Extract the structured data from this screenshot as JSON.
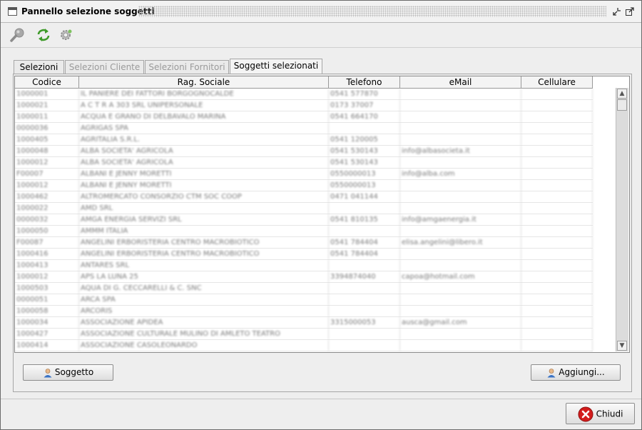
{
  "window": {
    "title": "Pannello selezione soggetti"
  },
  "toolbar": {
    "icons": [
      "search-icon",
      "refresh-icon",
      "settings-icon"
    ]
  },
  "tabs": [
    {
      "label": "Selezioni",
      "state": "enabled"
    },
    {
      "label": "Selezioni Cliente",
      "state": "disabled"
    },
    {
      "label": "Selezioni Fornitori",
      "state": "disabled"
    },
    {
      "label": "Soggetti selezionati",
      "state": "active"
    }
  ],
  "table": {
    "columns": [
      "Codice",
      "Rag. Sociale",
      "Telefono",
      "eMail",
      "Cellulare"
    ],
    "rows": [
      [
        "1000001",
        "IL PANIERE DEI FATTORI BORGOGNOCALDE",
        "0541 577870",
        "",
        ""
      ],
      [
        "1000021",
        "A C T R A 303 SRL UNIPERSONALE",
        "0173 37007",
        "",
        ""
      ],
      [
        "1000011",
        "ACQUA E GRANO DI DELBAVALO MARINA",
        "0541 664170",
        "",
        ""
      ],
      [
        "0000036",
        "AGRIGAS SPA",
        "",
        "",
        ""
      ],
      [
        "1000405",
        "AGRITALIA S.R.L.",
        "0541 120005",
        "",
        ""
      ],
      [
        "1000048",
        "ALBA SOCIETA' AGRICOLA",
        "0541 530143",
        "info@albasocieta.it",
        ""
      ],
      [
        "1000012",
        "ALBA SOCIETA' AGRICOLA",
        "0541 530143",
        "",
        ""
      ],
      [
        "F00007",
        "ALBANI E JENNY MORETTI",
        "0550000013",
        "info@alba.com",
        ""
      ],
      [
        "1000012",
        "ALBANI E JENNY MORETTI",
        "0550000013",
        "",
        ""
      ],
      [
        "1000462",
        "ALTROMERCATO CONSORZIO CTM SOC COOP",
        "0471 041144",
        "",
        ""
      ],
      [
        "1000022",
        "AMD SRL",
        "",
        "",
        ""
      ],
      [
        "0000032",
        "AMGA ENERGIA SERVIZI SRL",
        "0541 810135",
        "info@amgaenergia.it",
        ""
      ],
      [
        "1000050",
        "AMMM ITALIA",
        "",
        "",
        ""
      ],
      [
        "F00087",
        "ANGELINI ERBORISTERIA CENTRO MACROBIOTICO",
        "0541 784404",
        "elisa.angelini@libero.it",
        ""
      ],
      [
        "1000416",
        "ANGELINI ERBORISTERIA CENTRO MACROBIOTICO",
        "0541 784404",
        "",
        ""
      ],
      [
        "1000413",
        "ANTARES SRL",
        "",
        "",
        ""
      ],
      [
        "1000012",
        "APS LA LUNA 25",
        "3394874040",
        "capoa@hotmail.com",
        ""
      ],
      [
        "1000503",
        "AQUA DI G. CECCARELLI & C. SNC",
        "",
        "",
        ""
      ],
      [
        "0000051",
        "ARCA SPA",
        "",
        "",
        ""
      ],
      [
        "1000058",
        "ARCORIS",
        "",
        "",
        ""
      ],
      [
        "1000034",
        "ASSOCIAZIONE APIDEA",
        "3315000053",
        "ausca@gmail.com",
        ""
      ],
      [
        "1000427",
        "ASSOCIAZIONE CULTURALE MULINO DI AMLETO TEATRO",
        "",
        "",
        ""
      ],
      [
        "1000414",
        "ASSOCIAZIONE CASOLEONARDO",
        "",
        "",
        ""
      ]
    ]
  },
  "buttons": {
    "soggetto": "Soggetto",
    "aggiungi": "Aggiungi...",
    "chiudi": "Chiudi"
  },
  "colors": {
    "accent_close": "#d31d1d",
    "user_icon": "#3a72c4"
  }
}
